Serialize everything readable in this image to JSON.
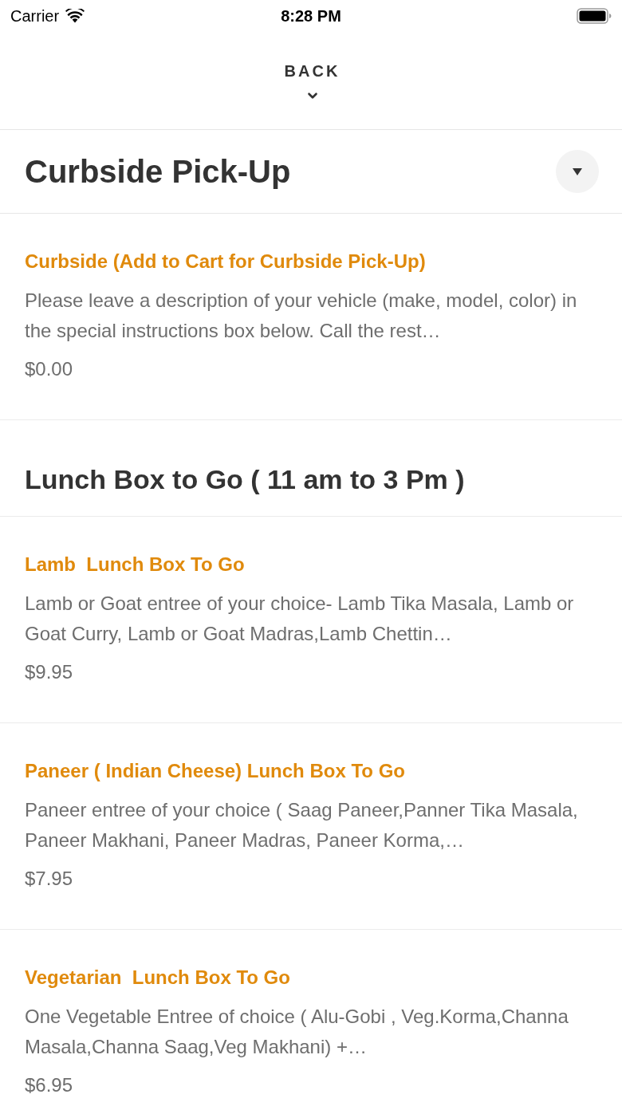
{
  "status_bar": {
    "carrier": "Carrier",
    "time": "8:28 PM"
  },
  "nav": {
    "back_label": "BACK"
  },
  "category_picker": {
    "label": "Curbside Pick-Up"
  },
  "sections": [
    {
      "items": [
        {
          "name": "Curbside (Add to Cart for Curbside Pick-Up)",
          "description": "Please leave a description of your vehicle (make, model, color) in the special instructions box below. Call the rest…",
          "price": "$0.00"
        }
      ]
    },
    {
      "heading": "Lunch Box to Go ( 11 am to 3 Pm )",
      "items": [
        {
          "name": "Lamb  Lunch Box To Go",
          "description": "Lamb or Goat entree of your choice- Lamb Tika Masala, Lamb or Goat Curry, Lamb or Goat Madras,Lamb Chettin…",
          "price": "$9.95"
        },
        {
          "name": "Paneer ( Indian Cheese) Lunch Box To Go",
          "description": "Paneer entree of your choice ( Saag Paneer,Panner Tika Masala, Paneer Makhani, Paneer Madras, Paneer Korma,…",
          "price": "$7.95"
        },
        {
          "name": "Vegetarian  Lunch Box To Go",
          "description": "One Vegetable Entree of choice ( Alu-Gobi , Veg.Korma,Channa Masala,Channa Saag,Veg Makhani) +…",
          "price": "$6.95"
        }
      ]
    }
  ]
}
